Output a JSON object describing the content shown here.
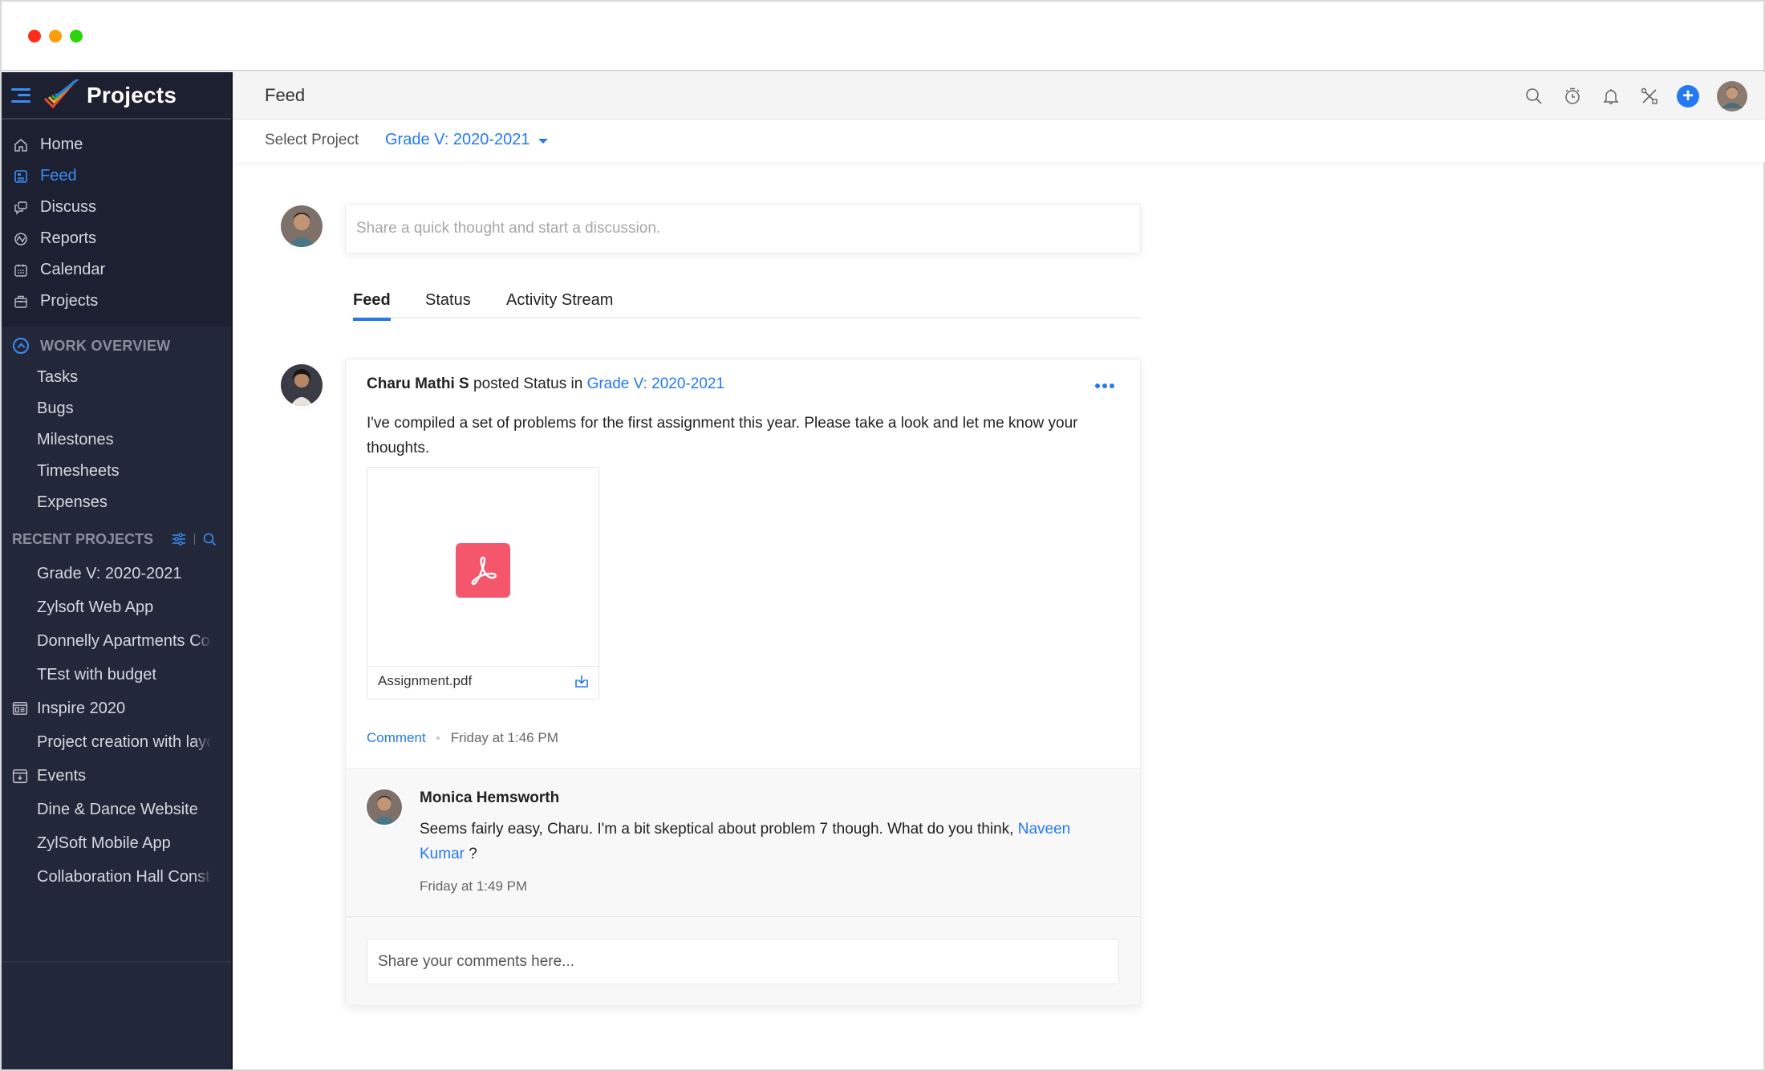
{
  "window": {
    "controls": [
      "close",
      "minimize",
      "maximize"
    ]
  },
  "app": {
    "name": "Projects",
    "menu_icon": "hamburger-icon",
    "logo_icon": "zoho-projects-check-logo"
  },
  "sidebar": {
    "nav": [
      {
        "label": "Home",
        "icon": "home-icon",
        "active": false
      },
      {
        "label": "Feed",
        "icon": "feed-icon",
        "active": true
      },
      {
        "label": "Discuss",
        "icon": "discuss-icon",
        "active": false
      },
      {
        "label": "Reports",
        "icon": "reports-icon",
        "active": false
      },
      {
        "label": "Calendar",
        "icon": "calendar-icon",
        "active": false
      },
      {
        "label": "Projects",
        "icon": "briefcase-icon",
        "active": false
      }
    ],
    "work_overview": {
      "label": "WORK OVERVIEW",
      "items": [
        "Tasks",
        "Bugs",
        "Milestones",
        "Timesheets",
        "Expenses"
      ]
    },
    "recent_projects": {
      "label": "RECENT PROJECTS",
      "tool_icons": [
        "filter-icon",
        "search-icon"
      ],
      "items": [
        {
          "label": "Grade V: 2020-2021",
          "icon": null
        },
        {
          "label": "Zylsoft Web App",
          "icon": null
        },
        {
          "label": "Donnelly Apartments Construction",
          "icon": null
        },
        {
          "label": "TEst with budget",
          "icon": null
        },
        {
          "label": "Inspire 2020",
          "icon": "project-group-icon"
        },
        {
          "label": "Project creation with layout",
          "icon": null
        },
        {
          "label": "Events",
          "icon": "project-group-icon"
        },
        {
          "label": "Dine & Dance Website",
          "icon": null
        },
        {
          "label": "ZylSoft Mobile App",
          "icon": null
        },
        {
          "label": "Collaboration Hall Construction",
          "icon": null
        }
      ]
    }
  },
  "header": {
    "title": "Feed",
    "icons": [
      "search-icon",
      "timer-icon",
      "bell-icon",
      "tools-icon",
      "add-icon",
      "user-avatar"
    ]
  },
  "subheader": {
    "label": "Select Project",
    "selected_project": "Grade V: 2020-2021"
  },
  "composer": {
    "placeholder": "Share a quick thought and start a discussion."
  },
  "tabs": [
    {
      "label": "Feed",
      "active": true
    },
    {
      "label": "Status",
      "active": false
    },
    {
      "label": "Activity Stream",
      "active": false
    }
  ],
  "post": {
    "author": "Charu Mathi S",
    "action": " posted Status in ",
    "project": "Grade V: 2020-2021",
    "body": "I've compiled a set of problems for the first assignment this year. Please take a look and let me know your thoughts.",
    "attachment": {
      "name": "Assignment.pdf",
      "type": "pdf"
    },
    "comment_label": "Comment",
    "time": "Friday at 1:46 PM",
    "comments": [
      {
        "author": "Monica Hemsworth",
        "text": "Seems fairly easy, Charu. I'm a bit skeptical about problem 7 though. What do you think, ",
        "mention": "Naveen Kumar",
        "text_after": " ?",
        "time": "Friday at 1:49 PM"
      }
    ],
    "reply_placeholder": "Share your comments here..."
  },
  "colors": {
    "accent": "#2479f2",
    "sidebar_bg": "#23273a",
    "sidebar_top_bg": "#1d2030",
    "pdf_red": "#f4566c"
  }
}
